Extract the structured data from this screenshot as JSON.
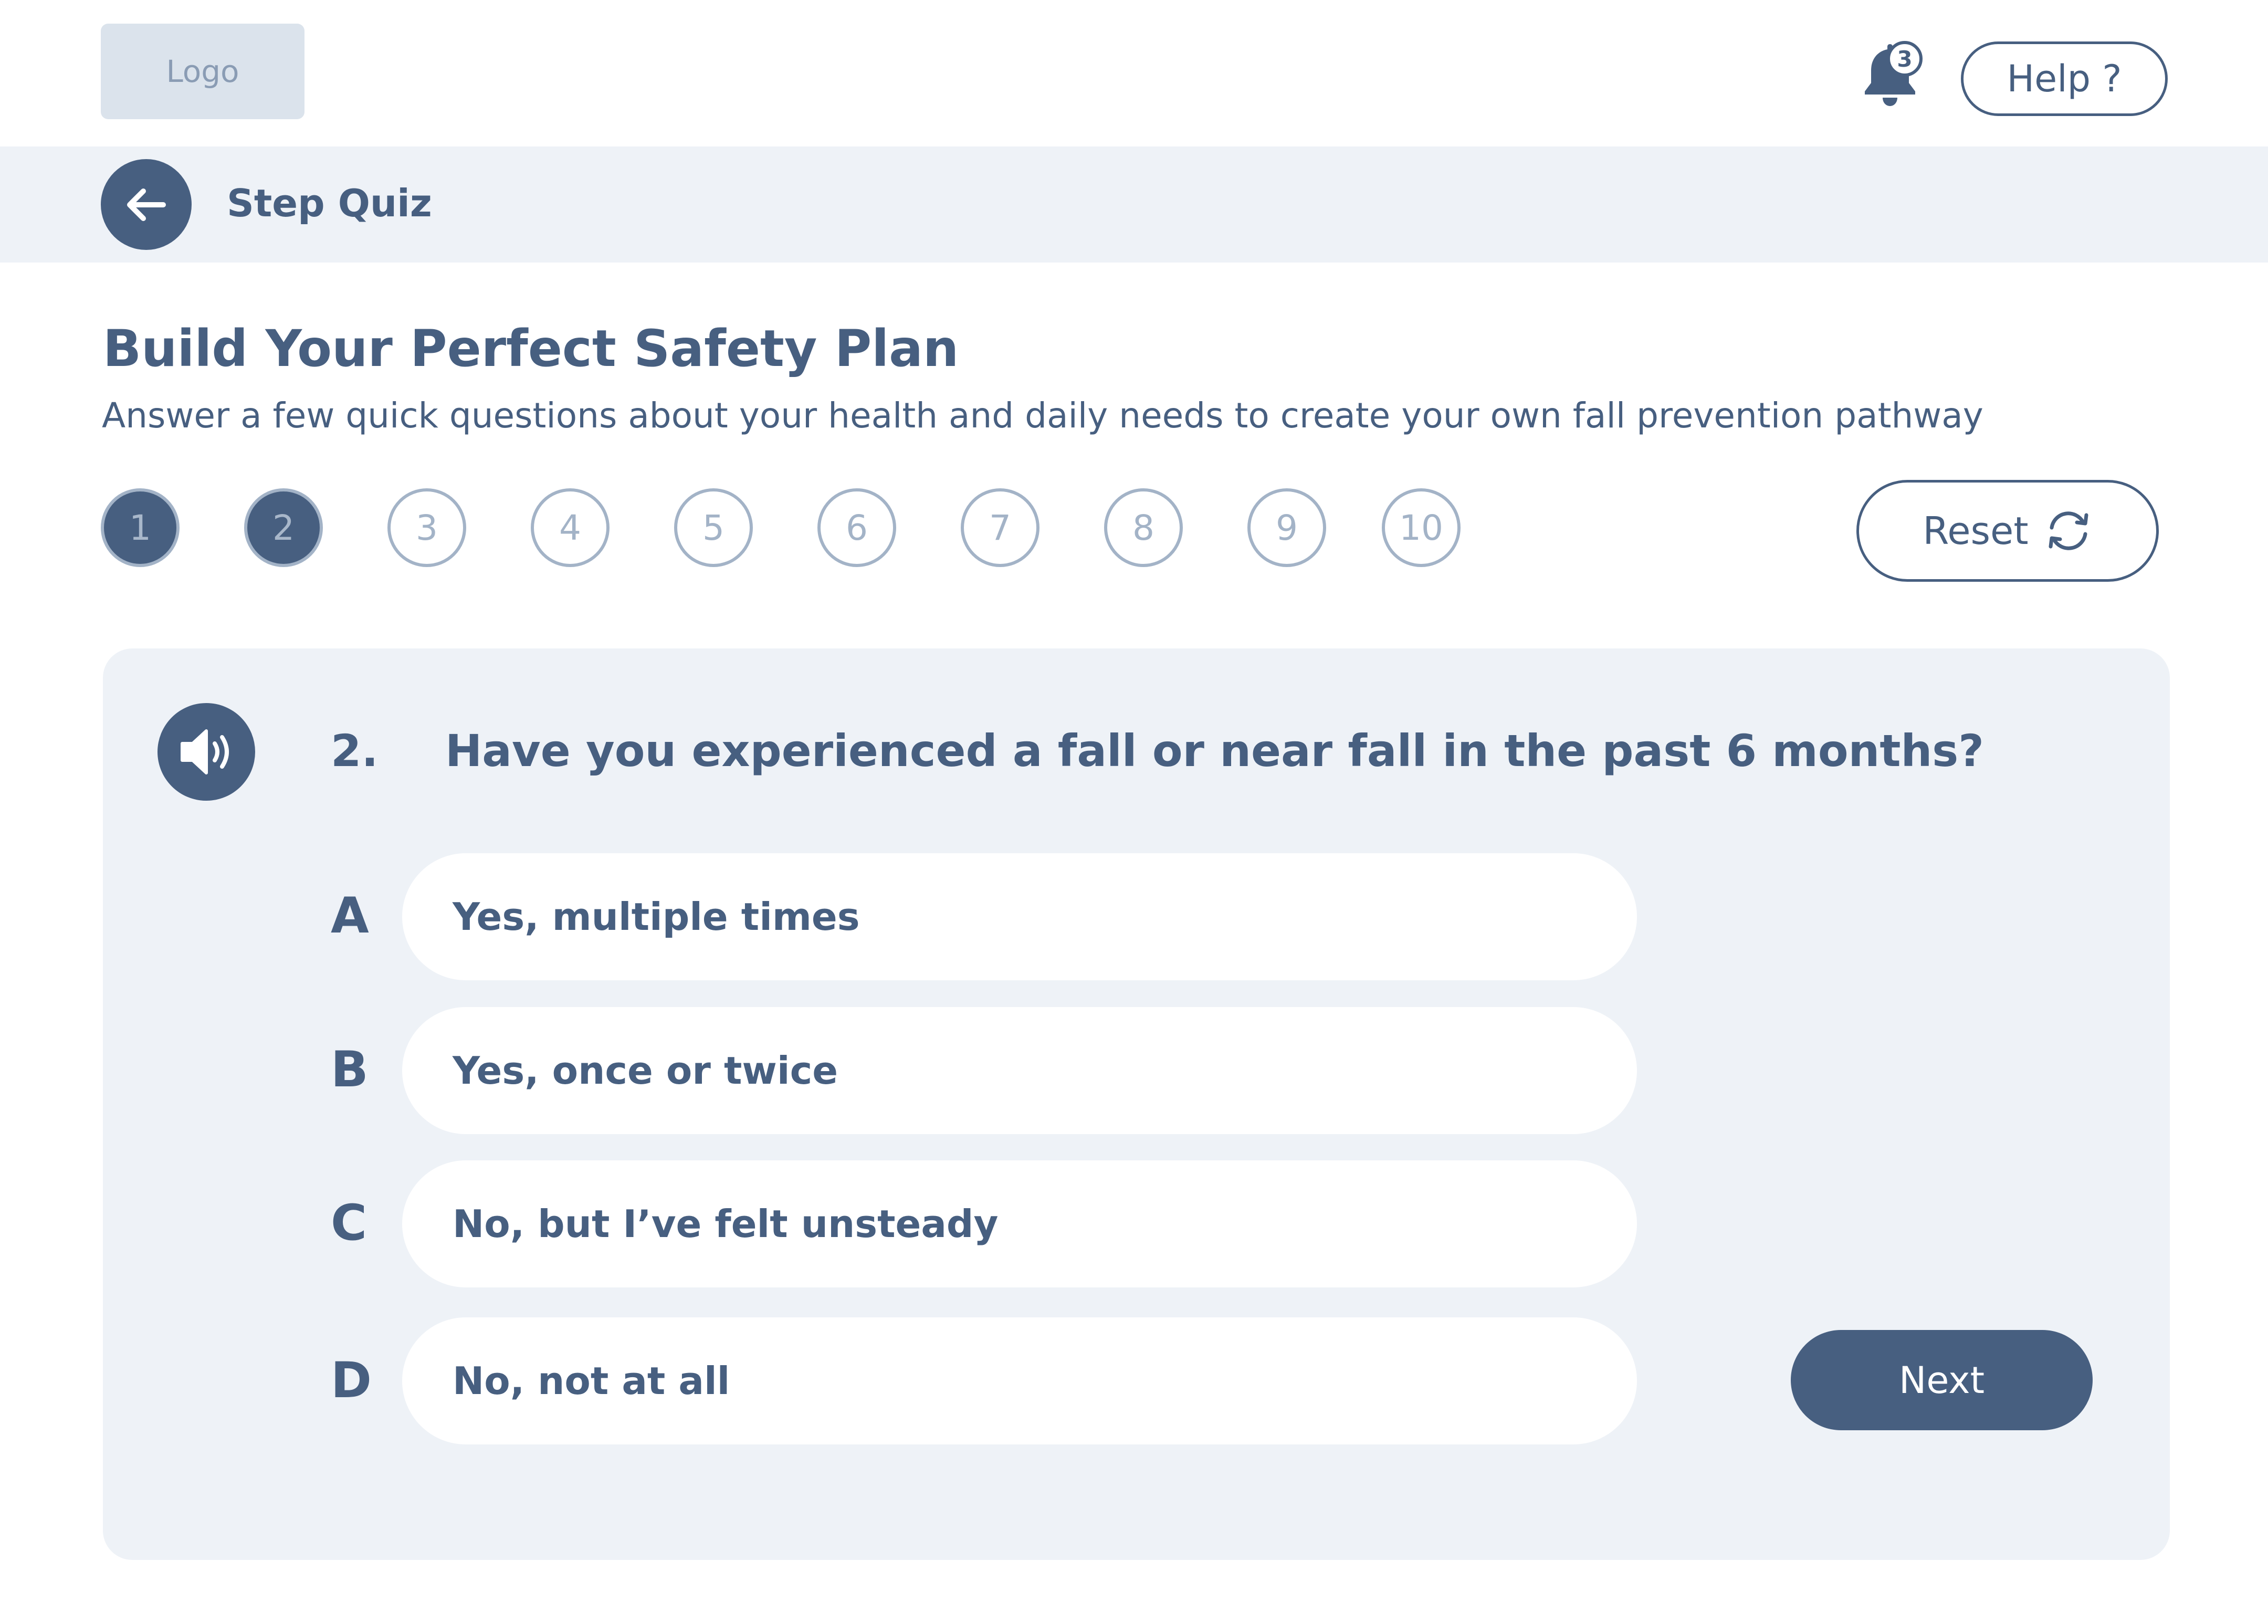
{
  "header": {
    "logo_label": "Logo",
    "notification_count": "3",
    "help_label": "Help ?"
  },
  "subbar": {
    "title": "Step Quiz"
  },
  "page": {
    "title": "Build Your Perfect Safety Plan",
    "subtitle": "Answer a few quick questions about your health and daily needs to create your own fall prevention pathway"
  },
  "steps": {
    "labels": [
      "1",
      "2",
      "3",
      "4",
      "5",
      "6",
      "7",
      "8",
      "9",
      "10"
    ],
    "completed": 2
  },
  "reset_label": "Reset",
  "question": {
    "number": "2.",
    "text": "Have you experienced a fall or near fall in the past 6 months?",
    "options": [
      {
        "letter": "A",
        "text": "Yes, multiple times"
      },
      {
        "letter": "B",
        "text": "Yes, once or twice"
      },
      {
        "letter": "C",
        "text": "No, but I’ve felt unsteady"
      },
      {
        "letter": "D",
        "text": "No, not at all"
      }
    ]
  },
  "next_label": "Next",
  "icons": {
    "back": "arrow-left-icon",
    "bell": "bell-icon",
    "reset": "refresh-icon",
    "audio": "speaker-icon"
  },
  "colors": {
    "primary": "#475f80",
    "muted": "#a3b3c7",
    "panel": "#eef2f7",
    "logo_bg": "#dbe3ec"
  }
}
